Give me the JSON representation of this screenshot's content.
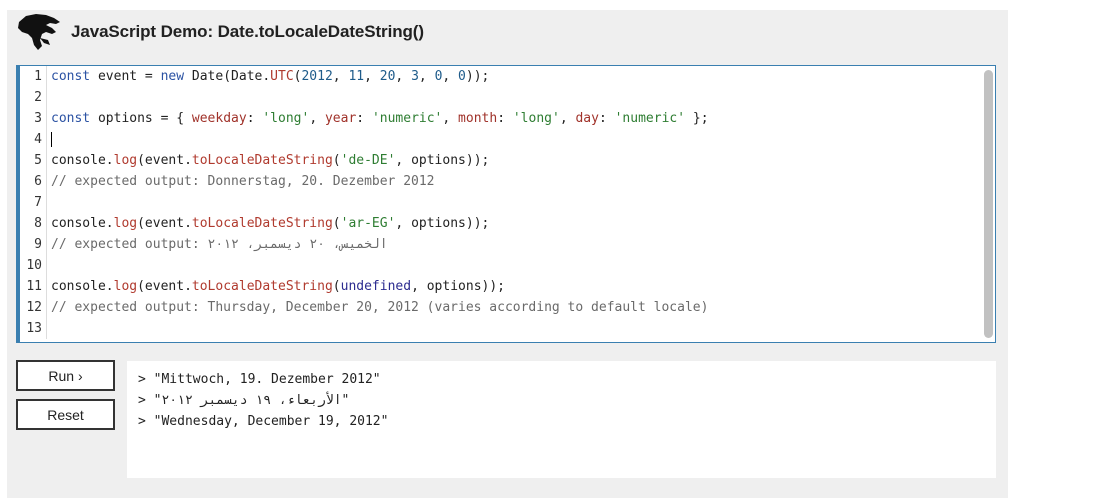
{
  "title": "JavaScript Demo: Date.toLocaleDateString()",
  "logo_icon": "dinosaur-logo-icon",
  "code_lines": [
    {
      "n": "1"
    },
    {
      "n": "2"
    },
    {
      "n": "3"
    },
    {
      "n": "4"
    },
    {
      "n": "5"
    },
    {
      "n": "6"
    },
    {
      "n": "7"
    },
    {
      "n": "8"
    },
    {
      "n": "9"
    },
    {
      "n": "10"
    },
    {
      "n": "11"
    },
    {
      "n": "12"
    },
    {
      "n": "13"
    }
  ],
  "code": {
    "l1": {
      "kw1": "const",
      "a": " event = ",
      "kw2": "new",
      "b": " Date(Date.",
      "fn": "UTC",
      "c": "(",
      "n1": "2012",
      "d": ", ",
      "n2": "11",
      "e": ", ",
      "n3": "20",
      "f": ", ",
      "n4": "3",
      "g": ", ",
      "n5": "0",
      "h": ", ",
      "n6": "0",
      "i": "));"
    },
    "l3": {
      "kw": "const",
      "a": " options = { ",
      "p1": "weekday",
      "b": ": ",
      "s1": "'long'",
      "c": ", ",
      "p2": "year",
      "d": ": ",
      "s2": "'numeric'",
      "e": ", ",
      "p3": "month",
      "f": ": ",
      "s3": "'long'",
      "g": ", ",
      "p4": "day",
      "h": ": ",
      "s4": "'numeric'",
      "i": " };"
    },
    "l5": {
      "a": "console.",
      "fn1": "log",
      "b": "(event.",
      "fn2": "toLocaleDateString",
      "c": "(",
      "s": "'de-DE'",
      "d": ", options));"
    },
    "l6": "// expected output: Donnerstag, 20. Dezember 2012",
    "l8": {
      "a": "console.",
      "fn1": "log",
      "b": "(event.",
      "fn2": "toLocaleDateString",
      "c": "(",
      "s": "'ar-EG'",
      "d": ", options));"
    },
    "l9": "// expected output: الخميس، ٢٠ ديسمبر، ٢٠١٢",
    "l11": {
      "a": "console.",
      "fn1": "log",
      "b": "(event.",
      "fn2": "toLocaleDateString",
      "c": "(",
      "u": "undefined",
      "d": ", options));"
    },
    "l12": "// expected output: Thursday, December 20, 2012 (varies according to default locale)"
  },
  "buttons": {
    "run": "Run ›",
    "reset": "Reset"
  },
  "output": [
    "> \"Mittwoch, 19. Dezember 2012\"",
    "> \"الأربعاء، ١٩ ديسمبر ٢٠١٢\"",
    "> \"Wednesday, December 19, 2012\""
  ],
  "colors": {
    "accent": "#3a7fb0",
    "panel": "#efefef"
  }
}
